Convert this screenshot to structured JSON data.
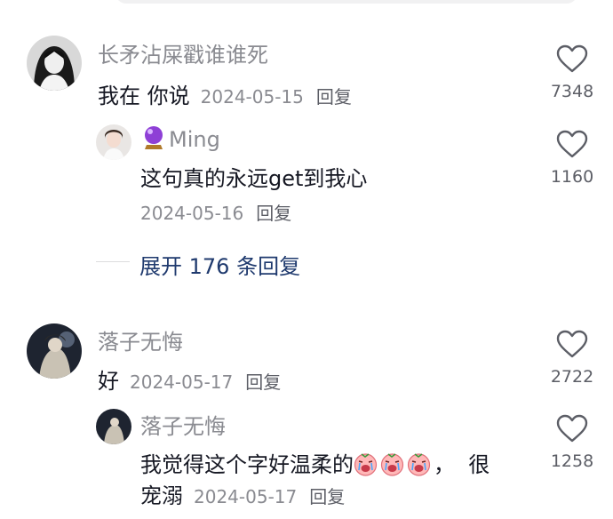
{
  "comments": [
    {
      "author": "长矛沾屎戳谁谁死",
      "text": "我在 你说",
      "date": "2024-05-15",
      "reply_label": "回复",
      "likes": "7348",
      "replies": [
        {
          "author": "Ming",
          "author_badge_icon": "purple-crystal-ball-icon",
          "text": "这句真的永远get到我心",
          "date": "2024-05-16",
          "reply_label": "回复",
          "likes": "1160"
        }
      ],
      "expand_label": "展开 176 条回复"
    },
    {
      "author": "落子无悔",
      "text": "好",
      "date": "2024-05-17",
      "reply_label": "回复",
      "likes": "2722",
      "replies": [
        {
          "author": "落子无悔",
          "text_line1": "我觉得这个字好温柔的",
          "emoji_icons": [
            "crying-face-emoji",
            "crying-face-emoji",
            "crying-face-emoji"
          ],
          "text_line1_end": "，  很",
          "text_line2": "宠溺",
          "date": "2024-05-17",
          "reply_label": "回复",
          "likes": "1258"
        }
      ]
    }
  ],
  "colors": {
    "author": "#8a8b91",
    "text": "#161823",
    "expand_link": "#1f3a6e",
    "heart_stroke": "#5c5e66"
  }
}
